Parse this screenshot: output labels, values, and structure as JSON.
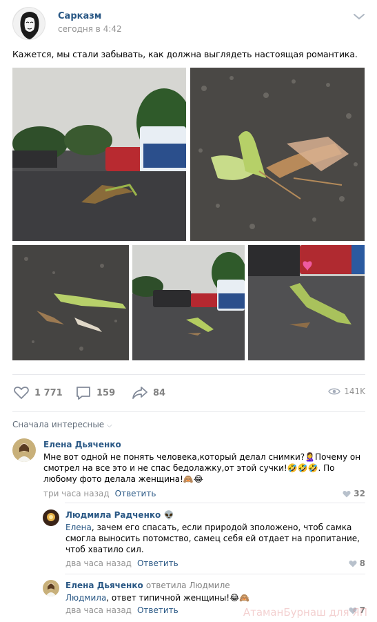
{
  "post": {
    "author": "Сарказм",
    "time": "сегодня в 4:42",
    "text": "Кажется, мы стали забывать, как должна выглядеть настоящая романтика."
  },
  "actions": {
    "likes": "1 771",
    "comments": "159",
    "shares": "84",
    "views": "141K"
  },
  "sort_label": "Сначала интересные",
  "comments": [
    {
      "author": "Елена Дьяченко",
      "text": "Мне вот одной не понять человека,который делал снимки?🙎‍♀️Почему он смотрел на все это и не спас бедолажку,от этой сучки!🤣🤣🤣. По любому фото делала женщина!🙈😂",
      "time": "три часа назад",
      "reply": "Ответить",
      "likes": "32"
    },
    {
      "author": "Людмила Радченко",
      "author_emoji": "👽",
      "mention": "Елена",
      "text": ", зачем его спасать, если природой зположено, чтоб самка смогла выносить потомство, самец себя ей отдает на пропитание, чтоб хватило сил.",
      "time": "два часа назад",
      "reply": "Ответить",
      "likes": "8"
    },
    {
      "author": "Елена Дьяченко",
      "replied_to": "ответила Людмиле",
      "mention": "Людмила",
      "text": ", ответ типичной женщины!😂🙈",
      "time": "два часа назад",
      "reply": "Ответить",
      "likes": "7"
    }
  ],
  "watermark": "АтаманБурнаш для ЯП",
  "colors": {
    "link": "#2a5885",
    "meta": "#939393",
    "divider": "#e7e8ec"
  }
}
